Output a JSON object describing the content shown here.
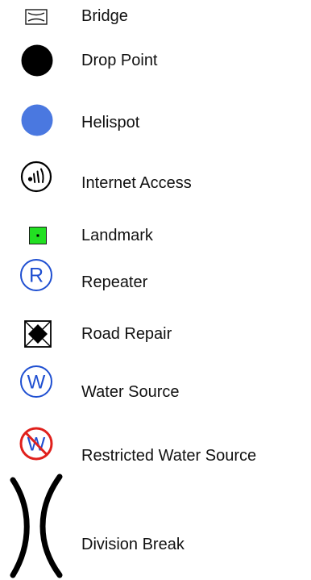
{
  "legend": {
    "items": [
      {
        "label": "Bridge",
        "icon": "bridge-icon",
        "color": "#1a1a1a"
      },
      {
        "label": "Drop Point",
        "icon": "drop-point-icon",
        "color": "#000000"
      },
      {
        "label": "Helispot",
        "icon": "helispot-icon",
        "color": "#4a78e0"
      },
      {
        "label": "Internet Access",
        "icon": "internet-access-icon",
        "color": "#000000"
      },
      {
        "label": "Landmark",
        "icon": "landmark-icon",
        "color": "#22e022"
      },
      {
        "label": "Repeater",
        "icon": "repeater-icon",
        "color": "#1f4fd1"
      },
      {
        "label": "Road Repair",
        "icon": "road-repair-icon",
        "color": "#000000"
      },
      {
        "label": "Water Source",
        "icon": "water-source-icon",
        "color": "#1f4fd1"
      },
      {
        "label": "Restricted Water Source",
        "icon": "restricted-water-source-icon",
        "color": "#e0201c"
      },
      {
        "label": "Division Break",
        "icon": "division-break-icon",
        "color": "#000000"
      }
    ]
  }
}
